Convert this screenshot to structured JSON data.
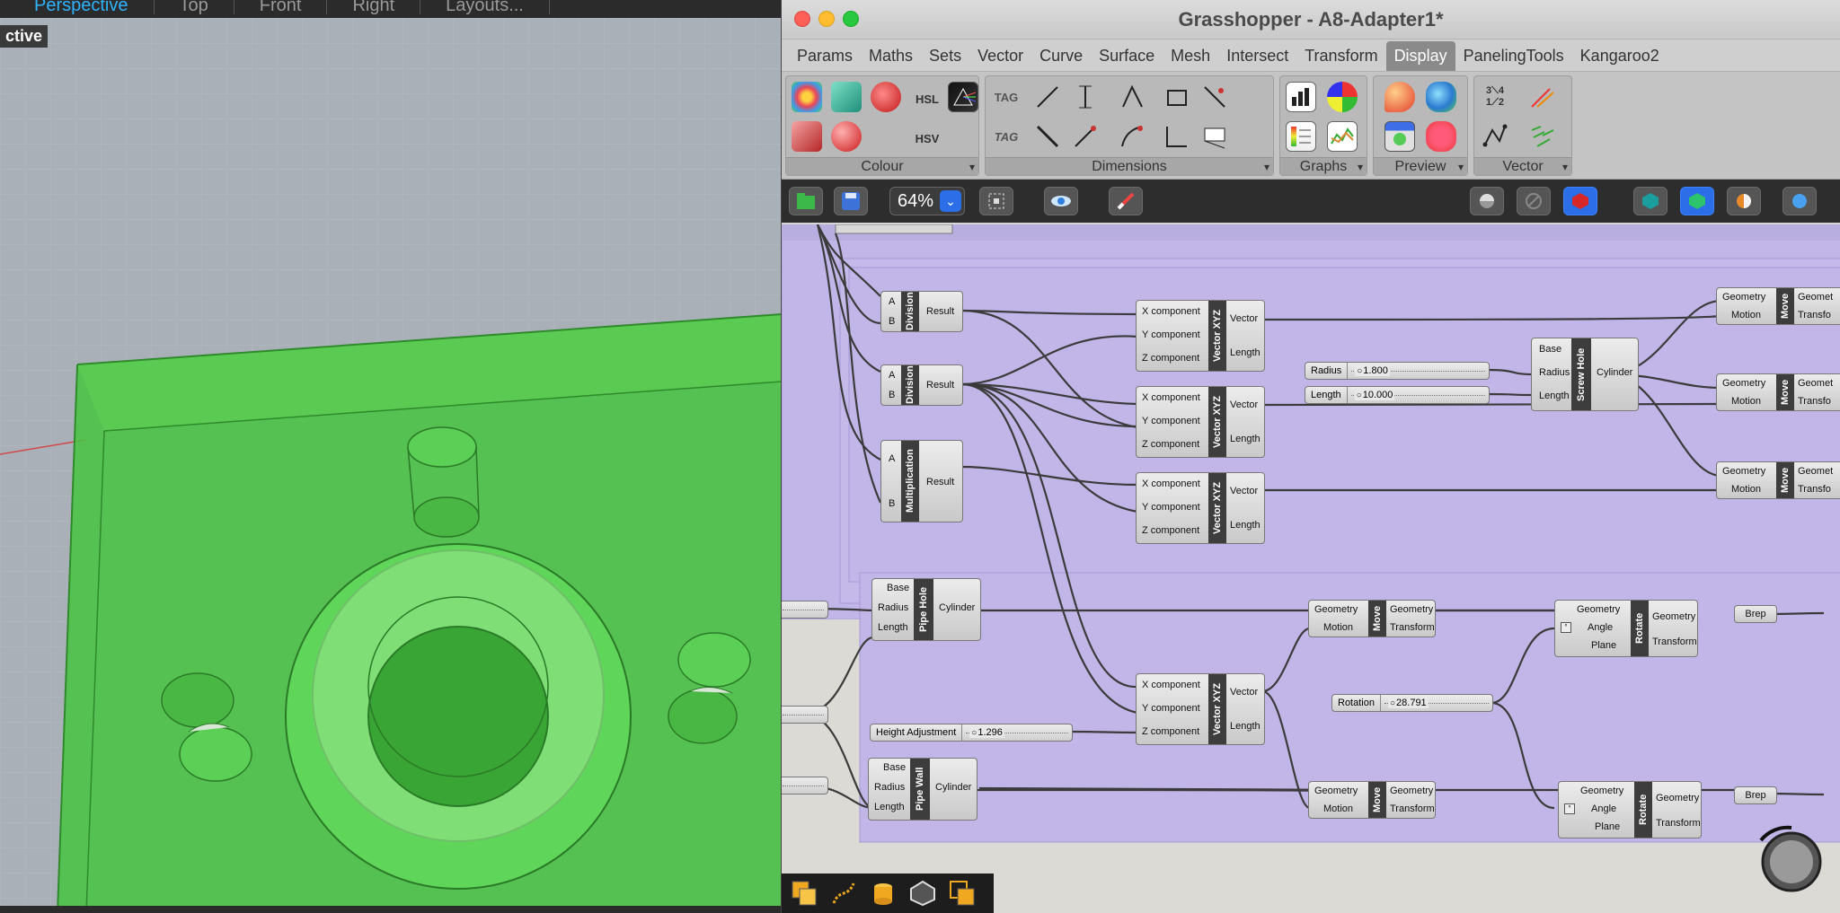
{
  "viewport": {
    "tabs": [
      "Perspective",
      "Top",
      "Front",
      "Right",
      "Layouts..."
    ],
    "active_tab": "Perspective",
    "label": "ctive"
  },
  "grasshopper": {
    "title": "Grasshopper - A8-Adapter1*",
    "menus": [
      "Params",
      "Maths",
      "Sets",
      "Vector",
      "Curve",
      "Surface",
      "Mesh",
      "Intersect",
      "Transform",
      "Display",
      "PanelingTools",
      "Kangaroo2"
    ],
    "active_menu": "Display",
    "ribbon_panels": [
      "Colour",
      "Dimensions",
      "Graphs",
      "Preview",
      "Vector"
    ],
    "zoom": "64%"
  },
  "canvas": {
    "division1": {
      "nick": "Division",
      "in_a": "A",
      "in_b": "B",
      "out": "Result"
    },
    "division2": {
      "nick": "Division",
      "in_a": "A",
      "in_b": "B",
      "out": "Result"
    },
    "multiplication": {
      "nick": "Multiplication",
      "in_a": "A",
      "in_b": "B",
      "out": "Result"
    },
    "vector": {
      "nick": "Vector XYZ",
      "in_x": "X component",
      "in_y": "Y component",
      "in_z": "Z component",
      "out_v": "Vector",
      "out_l": "Length"
    },
    "screw_hole": {
      "nick": "Screw Hole",
      "in_base": "Base",
      "in_radius": "Radius",
      "in_length": "Length",
      "out": "Cylinder"
    },
    "pipe_hole": {
      "nick": "Pipe Hole",
      "in_base": "Base",
      "in_radius": "Radius",
      "in_length": "Length",
      "out": "Cylinder"
    },
    "pipe_wall": {
      "nick": "Pipe Wall",
      "in_base": "Base",
      "in_radius": "Radius",
      "in_length": "Length",
      "out": "Cylinder"
    },
    "move": {
      "nick": "Move",
      "in_geo": "Geometry",
      "in_motion": "Motion",
      "out_geo": "Geometry",
      "out_tr": "Transform",
      "out_geo_cut": "Geomet",
      "out_tr_cut": "Transfo"
    },
    "rotate": {
      "nick": "Rotate",
      "in_geo": "Geometry",
      "in_angle": "Angle",
      "in_plane": "Plane",
      "out_geo": "Geometry",
      "out_tr": "Transform"
    },
    "brep": "Brep",
    "sliders": {
      "radius": {
        "label": "Radius",
        "value": "1.800"
      },
      "length": {
        "label": "Length",
        "value": "10.000"
      },
      "height": {
        "label": "Height Adjustment",
        "value": "1.296"
      },
      "rotation": {
        "label": "Rotation",
        "value": "28.791"
      }
    }
  },
  "colors": {
    "group_fill": "#c2b6e8",
    "viewport_bg": "#a6adb6",
    "part_green": "#3dbb3a",
    "accent_blue": "#2fb3ff"
  }
}
